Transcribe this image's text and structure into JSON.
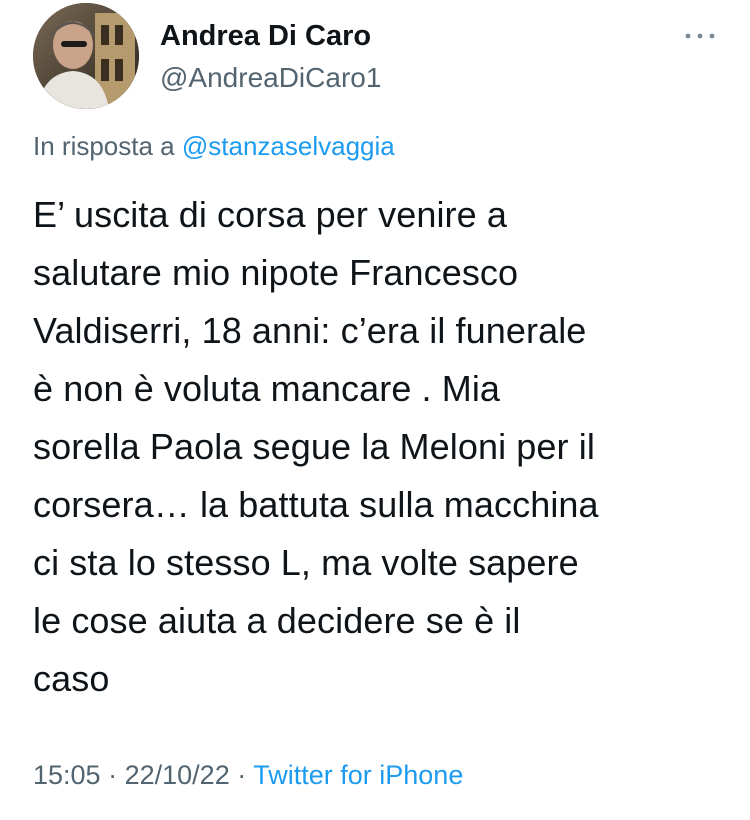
{
  "author": {
    "display_name": "Andrea Di Caro",
    "handle": "@AndreaDiCaro1"
  },
  "reply": {
    "prefix": "In risposta a",
    "mention": "@stanzaselvaggia"
  },
  "tweet": {
    "text": "E’ uscita di corsa per venire a\nsalutare mio nipote Francesco\nValdiserri, 18 anni: c’era il funerale\nè non è voluta mancare . Mia\nsorella Paola segue la Meloni per il\ncorsera… la battuta sulla macchina\nci sta lo stesso L, ma volte sapere\nle cose aiuta a decidere se è il\ncaso",
    "time": "15:05",
    "separator": "·",
    "date": "22/10/22",
    "source": "Twitter for iPhone"
  },
  "icons": {
    "more": "more-horizontal-icon",
    "avatar": "user-avatar"
  },
  "colors": {
    "text": "#0f1419",
    "secondary": "#536471",
    "link": "#1d9bf0"
  }
}
